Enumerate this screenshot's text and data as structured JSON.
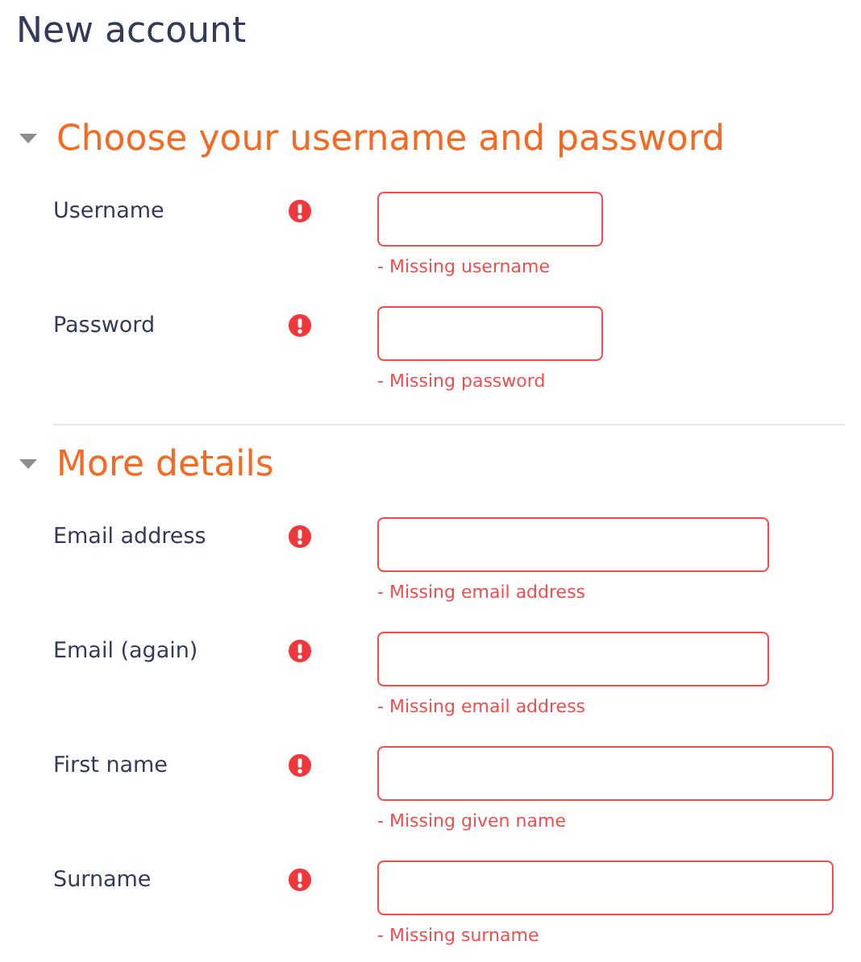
{
  "page_title": "New account",
  "sections": [
    {
      "title": "Choose your username and password",
      "expanded": true,
      "fields": [
        {
          "label": "Username",
          "required": true,
          "kind": "short",
          "error": "- Missing username"
        },
        {
          "label": "Password",
          "required": true,
          "kind": "short",
          "error": "- Missing password"
        }
      ]
    },
    {
      "title": "More details",
      "expanded": true,
      "fields": [
        {
          "label": "Email address",
          "required": true,
          "kind": "medium",
          "error": "- Missing email address"
        },
        {
          "label": "Email (again)",
          "required": true,
          "kind": "medium",
          "error": "- Missing email address"
        },
        {
          "label": "First name",
          "required": true,
          "kind": "long",
          "error": "- Missing given name"
        },
        {
          "label": "Surname",
          "required": true,
          "kind": "long",
          "error": "- Missing surname"
        }
      ]
    }
  ]
}
